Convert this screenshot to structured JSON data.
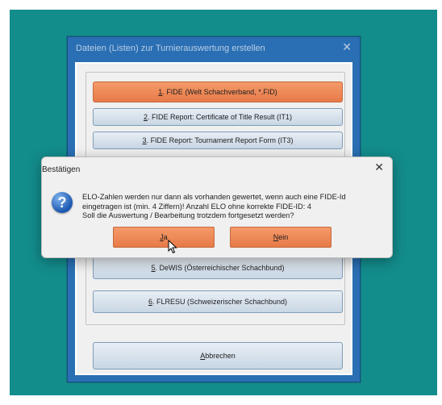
{
  "background_window": {
    "title": "Dateien (Listen) zur Turnierauswertung erstellen",
    "close_glyph": "✕",
    "buttons": [
      {
        "hotkey": "1",
        "rest": ". FIDE (Welt Schachverband, *.FID)"
      },
      {
        "hotkey": "2",
        "rest": ". FIDE Report: Certificate of Title Result (IT1)"
      },
      {
        "hotkey": "3",
        "rest": ". FIDE Report: Tournament Report Form (IT3)"
      },
      {
        "hotkey": "5",
        "rest": ". DeWIS (Österreichischer Schachbund)"
      },
      {
        "hotkey": "6",
        "rest": ". FLRESU  (Schweizerischer Schachbund)"
      }
    ],
    "cancel": {
      "hotkey": "A",
      "rest": "bbrechen"
    }
  },
  "dialog": {
    "title": "Bestätigen",
    "close_glyph": "✕",
    "icon": "question-icon",
    "icon_glyph": "?",
    "message_lines": [
      "ELO-Zahlen werden nur dann als vorhanden gewertet, wenn auch eine FIDE-Id",
      "eingetragen ist (min. 4 Ziffern)! Anzahl ELO ohne korrekte FIDE-ID: 4",
      "Soll die Auswertung / Bearbeitung trotzdem fortgesetzt werden?"
    ],
    "yes": {
      "hotkey": "J",
      "rest": "a"
    },
    "no": {
      "hotkey": "N",
      "rest": "ein"
    }
  },
  "colors": {
    "desktop": "#138c8c",
    "window_frame": "#2a6fb3",
    "accent_button": "#e77a48",
    "normal_button": "#c8d6e4"
  }
}
